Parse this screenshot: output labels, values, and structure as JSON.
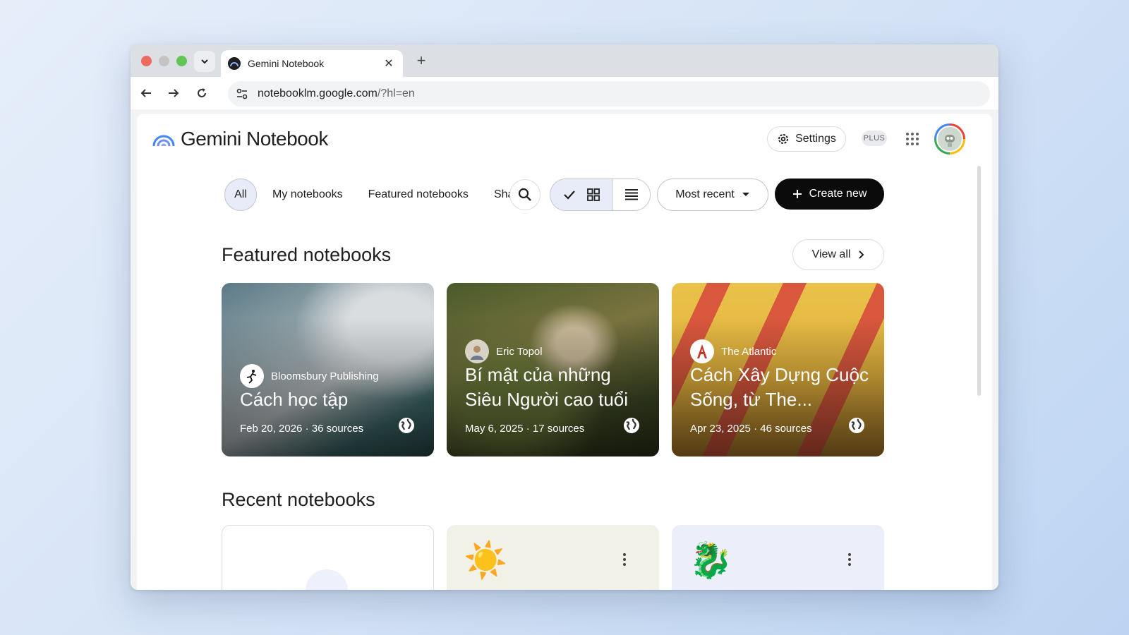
{
  "browser": {
    "tab_title": "Gemini Notebook",
    "tab_close": "✕",
    "new_tab": "+",
    "url_main": "notebooklm.google.com",
    "url_rest": "/?hl=en"
  },
  "header": {
    "brand": "Gemini Notebook",
    "settings_label": "Settings",
    "plan_badge": "PLUS"
  },
  "filters": {
    "chips": [
      "All",
      "My notebooks",
      "Featured notebooks",
      "Sha"
    ],
    "sort_label": "Most recent",
    "create_label": "Create new"
  },
  "featured": {
    "title": "Featured notebooks",
    "view_all": "View all",
    "cards": [
      {
        "author": "Bloomsbury Publishing",
        "title": "Cách học tập",
        "meta": "Feb 20, 2026 · 36 sources"
      },
      {
        "author": "Eric Topol",
        "title": "Bí mật của những Siêu Người cao tuổi",
        "meta": "May 6, 2025 · 17 sources"
      },
      {
        "author": "The Atlantic",
        "title": "Cách Xây Dựng Cuộc Sống, từ The...",
        "meta": "Apr 23, 2025 · 46 sources"
      }
    ]
  },
  "recent": {
    "title": "Recent notebooks",
    "cards": [
      {
        "emoji": ""
      },
      {
        "emoji": "☀️"
      },
      {
        "emoji": "🐉"
      }
    ]
  }
}
